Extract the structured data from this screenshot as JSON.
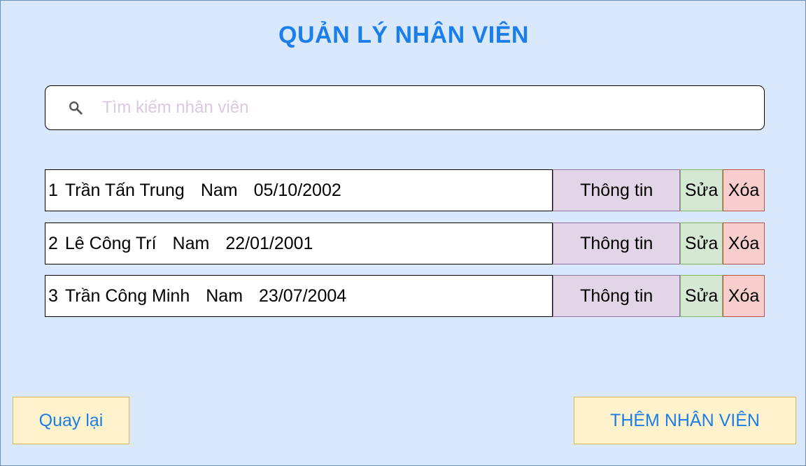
{
  "header": {
    "title": "QUẢN LÝ NHÂN VIÊN"
  },
  "search": {
    "placeholder": "Tìm kiếm nhân viên",
    "value": ""
  },
  "employees": [
    {
      "index": "1",
      "name": "Trần Tấn Trung",
      "gender": "Nam",
      "birthdate": "05/10/2002"
    },
    {
      "index": "2",
      "name": "Lê Công Trí",
      "gender": "Nam",
      "birthdate": "22/01/2001"
    },
    {
      "index": "3",
      "name": "Trần Công Minh",
      "gender": "Nam",
      "birthdate": "23/07/2004"
    }
  ],
  "row_actions": {
    "info_label": "Thông tin",
    "edit_label": "Sửa",
    "delete_label": "Xóa"
  },
  "footer": {
    "back_label": "Quay lại",
    "add_label": "THÊM NHÂN VIÊN"
  },
  "colors": {
    "background": "#dae8fc",
    "accent": "#1a7fea",
    "info_button": "#e1d5e7",
    "edit_button": "#d5e8d4",
    "delete_button": "#f8cecc",
    "footer_button": "#fff2cc"
  },
  "icons": {
    "search": "search-icon"
  }
}
